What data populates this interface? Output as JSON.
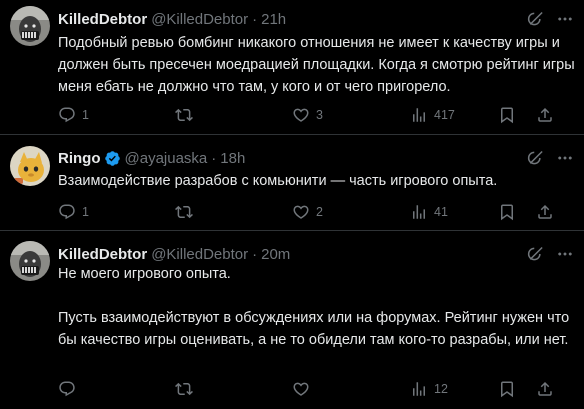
{
  "tweets": [
    {
      "name": "KilledDebtor",
      "handle": "@KilledDebtor",
      "dot": "·",
      "time": "21h",
      "text": "Подобный ревью бомбинг никакого отношения не имеет к качеству игры и должен быть пресечен моедрацией площадки. Когда я смотрю рейтинг игры меня ебать не должно что там, у кого и от чего пригорело.",
      "replies": "1",
      "retweets": "",
      "likes": "3",
      "views": "417",
      "verified": false
    },
    {
      "name": "Ringo",
      "handle": "@ayajuaska",
      "dot": "·",
      "time": "18h",
      "text": "Взаимодействие разрабов с комьюнити — часть игрового опыта.",
      "replies": "1",
      "retweets": "",
      "likes": "2",
      "views": "41",
      "verified": true
    },
    {
      "name": "KilledDebtor",
      "handle": "@KilledDebtor",
      "dot": "·",
      "time": "20m",
      "text": "Не моего игрового опыта.\n\nПусть взаимодействуют в обсуждениях или на форумах. Рейтинг нужен что бы качество игры оценивать, а не то обидели там кого-то разрабы, или нет.",
      "replies": "",
      "retweets": "",
      "likes": "",
      "views": "12",
      "verified": false
    }
  ],
  "colors": {
    "background": "#000000",
    "text": "#e7e9ea",
    "muted": "#71767b",
    "border": "#2f3336",
    "verified": "#1d9bf0"
  },
  "icons": [
    "grok-icon",
    "more-icon",
    "reply-icon",
    "retweet-icon",
    "like-icon",
    "views-icon",
    "bookmark-icon",
    "share-icon",
    "verified-badge-icon"
  ]
}
